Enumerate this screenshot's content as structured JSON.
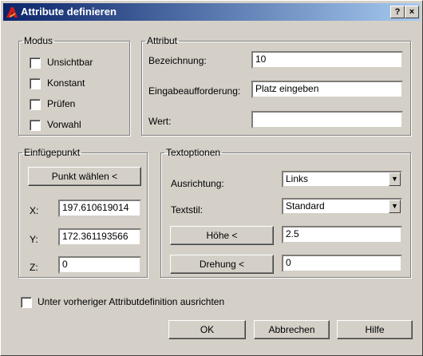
{
  "window": {
    "title": "Attribute definieren",
    "help_glyph": "?",
    "close_glyph": "×"
  },
  "modus": {
    "legend": "Modus",
    "items": [
      {
        "label": "Unsichtbar",
        "checked": false
      },
      {
        "label": "Konstant",
        "checked": false
      },
      {
        "label": "Prüfen",
        "checked": false
      },
      {
        "label": "Vorwahl",
        "checked": false
      }
    ]
  },
  "attribut": {
    "legend": "Attribut",
    "bezeichnung_label": "Bezeichnung:",
    "bezeichnung_value": "10",
    "eingabe_label": "Eingabeaufforderung:",
    "eingabe_value": "Platz eingeben",
    "wert_label": "Wert:",
    "wert_value": ""
  },
  "einfuegepunkt": {
    "legend": "Einfügepunkt",
    "pick_button": "Punkt wählen <",
    "x_label": "X:",
    "x_value": "197.610619014",
    "y_label": "Y:",
    "y_value": "172.361193566",
    "z_label": "Z:",
    "z_value": "0"
  },
  "textoptionen": {
    "legend": "Textoptionen",
    "ausrichtung_label": "Ausrichtung:",
    "ausrichtung_value": "Links",
    "textstil_label": "Textstil:",
    "textstil_value": "Standard",
    "hoehe_button": "Höhe <",
    "hoehe_value": "2.5",
    "drehung_button": "Drehung <",
    "drehung_value": "0"
  },
  "align_prev": {
    "label": "Unter vorheriger Attributdefinition ausrichten",
    "checked": false
  },
  "buttons": {
    "ok": "OK",
    "cancel": "Abbrechen",
    "help": "Hilfe"
  },
  "icons": {
    "app": "autocad-icon",
    "dropdown": "chevron-down-icon"
  },
  "colors": {
    "title_start": "#0a246a",
    "title_end": "#a6caf0",
    "face": "#d4d0c8"
  }
}
